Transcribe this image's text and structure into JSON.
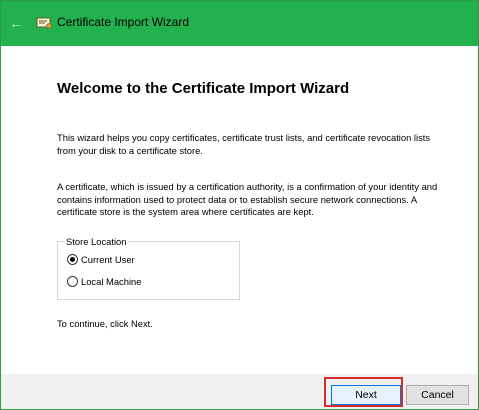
{
  "window": {
    "title": "Certificate Import Wizard",
    "back_icon": "back-arrow-icon",
    "title_icon": "certificate-icon",
    "titlebar_color": "#22b14c"
  },
  "main": {
    "heading": "Welcome to the Certificate Import Wizard",
    "paragraph1": "This wizard helps you copy certificates, certificate trust lists, and certificate revocation lists from your disk to a certificate store.",
    "paragraph2": "A certificate, which is issued by a certification authority, is a confirmation of your identity and contains information used to protect data or to establish secure network connections. A certificate store is the system area where certificates are kept.",
    "store_location": {
      "legend": "Store Location",
      "options": [
        {
          "label": "Current User",
          "selected": true
        },
        {
          "label": "Local Machine",
          "selected": false
        }
      ]
    },
    "continue_text": "To continue, click Next."
  },
  "footer": {
    "next_label": "Next",
    "cancel_label": "Cancel",
    "highlight_color": "#d62c2c"
  }
}
